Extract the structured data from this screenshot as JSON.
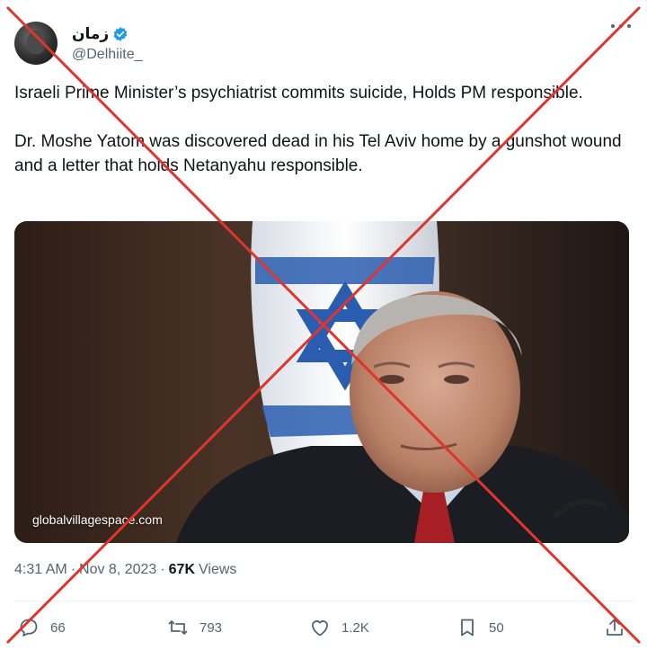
{
  "author": {
    "display_name": "زمان",
    "handle": "@Delhiite_",
    "verified": true
  },
  "tweet": {
    "paragraph1": "Israeli Prime Minister’s psychiatrist commits suicide, Holds PM responsible.",
    "paragraph2": "Dr. Moshe Yatom was discovered dead in his Tel Aviv home by a gunshot wound and a letter that holds Netanyahu responsible."
  },
  "media": {
    "caption": "globalvillagespace.com"
  },
  "meta": {
    "time": "4:31 AM",
    "separator": "·",
    "date": "Nov 8, 2023",
    "views_count": "67K",
    "views_label": "Views"
  },
  "actions": {
    "replies": "66",
    "reposts": "793",
    "likes": "1.2K",
    "bookmarks": "50"
  },
  "icons": {
    "verified": "verified-badge-icon",
    "more": "more-icon",
    "reply": "reply-icon",
    "repost": "repost-icon",
    "like": "heart-icon",
    "bookmark": "bookmark-icon",
    "share": "share-icon"
  },
  "colors": {
    "text": "#0f1419",
    "secondary": "#536471",
    "verified": "#1d9bf0",
    "cross": "#e0352b"
  }
}
